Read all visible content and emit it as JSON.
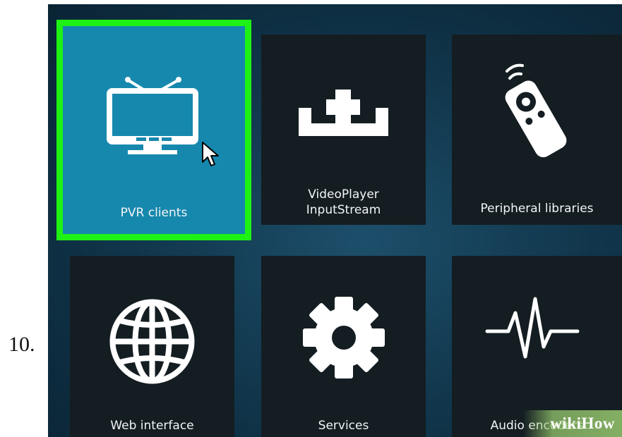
{
  "step_number": "10.",
  "tiles": [
    {
      "label": "PVR clients",
      "icon": "tv-icon",
      "focused": true
    },
    {
      "label": "VideoPlayer\nInputStream",
      "icon": "add-download-icon"
    },
    {
      "label": "Peripheral libraries",
      "icon": "remote-control-icon"
    },
    {
      "label": "Web interface",
      "icon": "globe-icon"
    },
    {
      "label": "Services",
      "icon": "gear-icon"
    },
    {
      "label": "Audio encoders",
      "icon": "waveform-icon"
    }
  ],
  "watermark": {
    "text": "wikiHow"
  },
  "colors": {
    "focus_border": "#1ef214",
    "focused_tile": "#1788ad",
    "tile": "#141d22",
    "background": "#133b52"
  }
}
